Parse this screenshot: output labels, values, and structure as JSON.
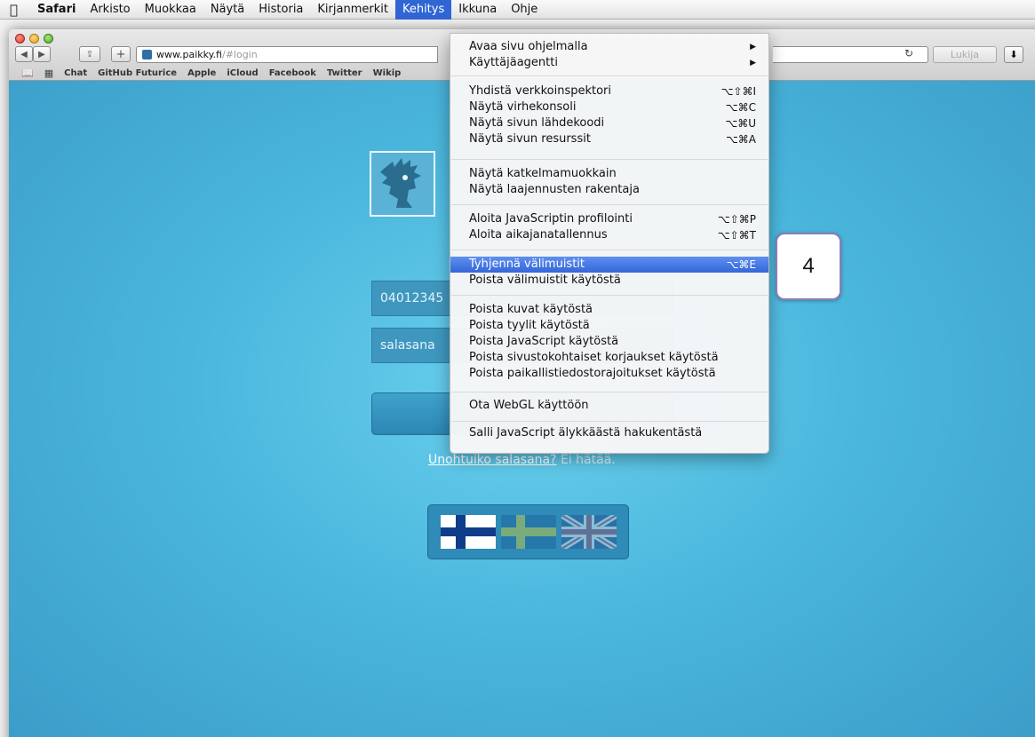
{
  "menubar": {
    "items": [
      "Safari",
      "Arkisto",
      "Muokkaa",
      "Näytä",
      "Historia",
      "Kirjanmerkit",
      "Kehitys",
      "Ikkuna",
      "Ohje"
    ],
    "active": "Kehitys"
  },
  "toolbar": {
    "url_host": "www.paikky.fi",
    "url_path": "/#login",
    "reader_label": "Lukija"
  },
  "bookmarks": [
    "Chat",
    "GitHub Futurice",
    "Apple",
    "iCloud",
    "Facebook",
    "Twitter",
    "Wikip"
  ],
  "login": {
    "phone_value": "04012345",
    "password_placeholder": "salasana",
    "forgot_link": "Unohtuiko salasana?",
    "forgot_rest": " Ei hätää."
  },
  "dropdown": {
    "items": [
      {
        "label": "Avaa sivu ohjelmalla",
        "shortcut": "▶"
      },
      {
        "label": "Käyttäjäagentti",
        "shortcut": "▶"
      },
      {
        "label": "Yhdistä verkkoinspektori",
        "shortcut": "⌥⇧⌘I"
      },
      {
        "label": "Näytä virhekonsoli",
        "shortcut": "⌥⌘C"
      },
      {
        "label": "Näytä sivun lähdekoodi",
        "shortcut": "⌥⌘U"
      },
      {
        "label": "Näytä sivun resurssit",
        "shortcut": "⌥⌘A"
      },
      {
        "label": "Näytä katkelmamuokkain",
        "shortcut": ""
      },
      {
        "label": "Näytä laajennusten rakentaja",
        "shortcut": ""
      },
      {
        "label": "Aloita JavaScriptin profilointi",
        "shortcut": "⌥⇧⌘P"
      },
      {
        "label": "Aloita aikajanatallennus",
        "shortcut": "⌥⇧⌘T"
      },
      {
        "label": "Tyhjennä välimuistit",
        "shortcut": "⌥⌘E"
      },
      {
        "label": "Poista välimuistit käytöstä",
        "shortcut": ""
      },
      {
        "label": "Poista kuvat käytöstä",
        "shortcut": ""
      },
      {
        "label": "Poista tyylit käytöstä",
        "shortcut": ""
      },
      {
        "label": "Poista JavaScript käytöstä",
        "shortcut": ""
      },
      {
        "label": "Poista sivustokohtaiset korjaukset käytöstä",
        "shortcut": ""
      },
      {
        "label": "Poista paikallistiedostorajoitukset käytöstä",
        "shortcut": ""
      },
      {
        "label": "Ota WebGL käyttöön",
        "shortcut": ""
      },
      {
        "label": "Salli JavaScript älykkäästä hakukentästä",
        "shortcut": ""
      }
    ]
  },
  "callout": {
    "label": "4"
  },
  "colors": {
    "menu_highlight": "#3466d8",
    "page_bg": "#4bb7dd",
    "callout_border": "#8e7bb6"
  }
}
